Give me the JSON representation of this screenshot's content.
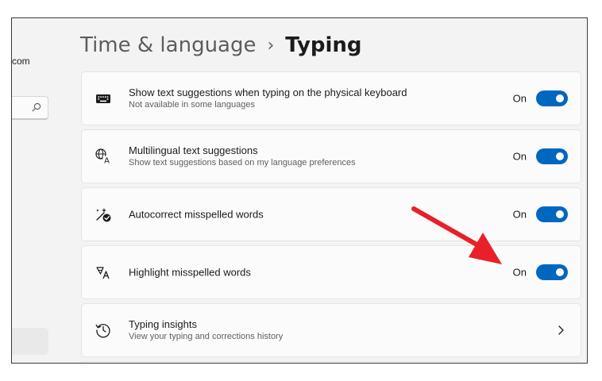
{
  "sidebar": {
    "account_email_fragment": "com",
    "search_icon": "search-icon"
  },
  "breadcrumb": {
    "parent": "Time & language",
    "separator": "›",
    "current": "Typing"
  },
  "settings": [
    {
      "icon": "keyboard-icon",
      "title": "Show text suggestions when typing on the physical keyboard",
      "description": "Not available in some languages",
      "state": "On",
      "toggle_on": true
    },
    {
      "icon": "multilingual-icon",
      "title": "Multilingual text suggestions",
      "description": "Show text suggestions based on my language preferences",
      "state": "On",
      "toggle_on": true
    },
    {
      "icon": "autocorrect-icon",
      "title": "Autocorrect misspelled words",
      "state": "On",
      "toggle_on": true
    },
    {
      "icon": "highlight-spelling-icon",
      "title": "Highlight misspelled words",
      "state": "On",
      "toggle_on": true
    },
    {
      "icon": "history-icon",
      "title": "Typing insights",
      "description": "View your typing and corrections history",
      "action_icon": "chevron-right-icon"
    }
  ],
  "colors": {
    "accent": "#0067c0",
    "annotation_arrow": "#e8202a",
    "window_background": "#f3f3f3",
    "card_background": "#fbfbfb"
  }
}
